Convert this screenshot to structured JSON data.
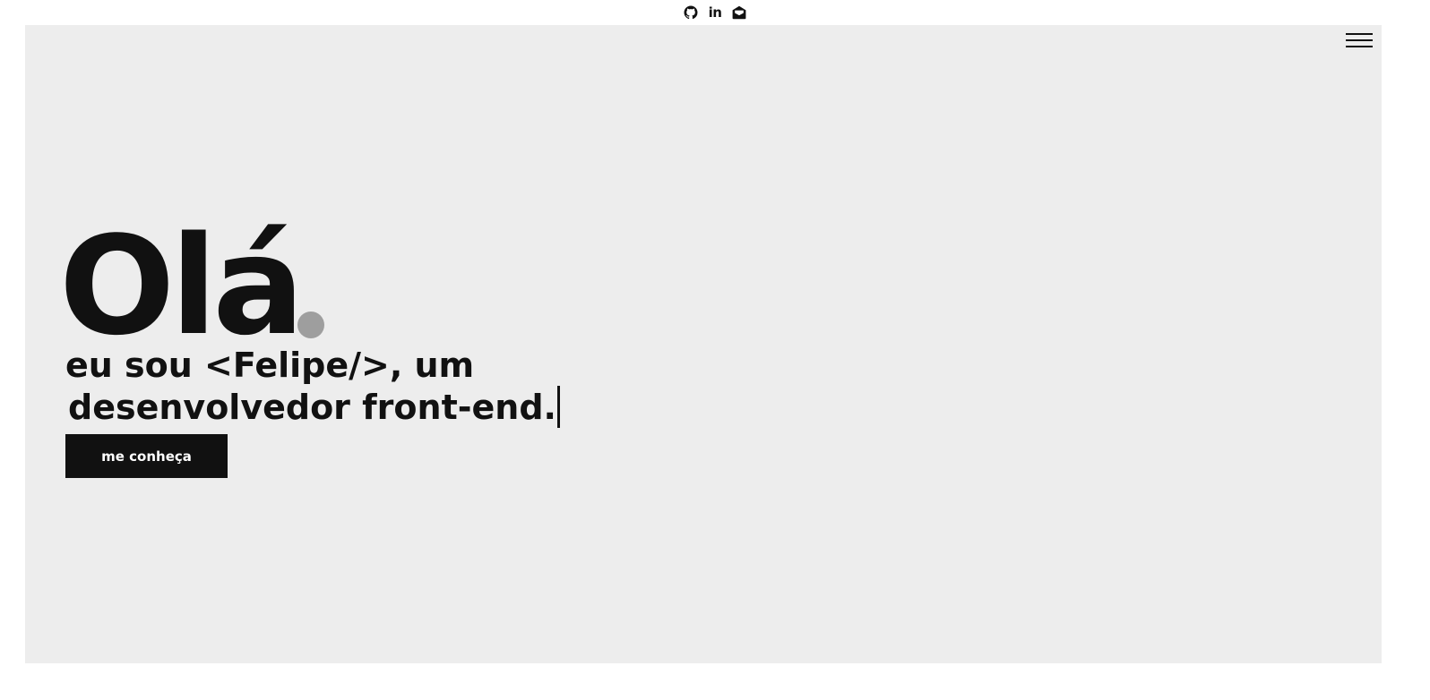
{
  "social": {
    "github_icon": "github-icon",
    "linkedin_label": "in",
    "linkedin_icon": "linkedin-icon",
    "email_icon": "envelope-open-icon"
  },
  "header": {
    "menu_icon": "hamburger-menu-icon"
  },
  "hero": {
    "greeting": "Olá",
    "intro_line1": "eu sou <Felipe/>, um",
    "intro_line2": "desenvolvedor front-end.",
    "cta_label": "me conheça"
  },
  "colors": {
    "hero_background": "#ededed",
    "text": "#111111",
    "accent_dot": "#9e9e9e",
    "button_background": "#111111",
    "button_text": "#ffffff"
  }
}
